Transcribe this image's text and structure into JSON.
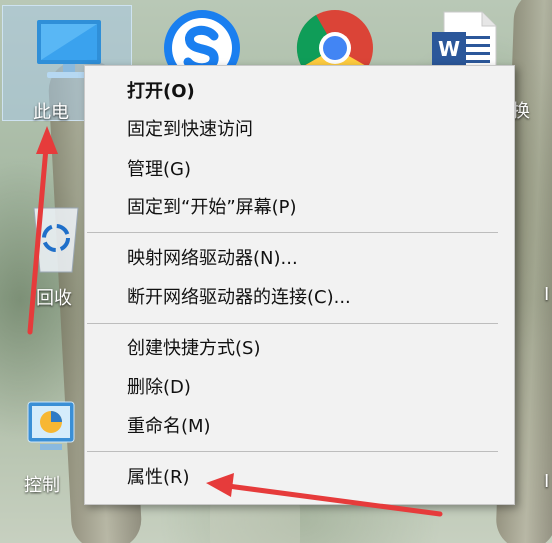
{
  "desktop": {
    "icons": [
      {
        "label": "此电",
        "name": "this-pc-icon"
      },
      {
        "label": "回收",
        "name": "recycle-bin-icon"
      },
      {
        "label": "控制",
        "name": "control-panel-icon"
      }
    ],
    "right_labels": [
      "换"
    ]
  },
  "menu": {
    "items": [
      {
        "label": "打开(O)",
        "bold": true
      },
      {
        "label": "固定到快速访问"
      },
      {
        "label": "管理(G)"
      },
      {
        "label": "固定到“开始”屏幕(P)"
      },
      {
        "label": "映射网络驱动器(N)..."
      },
      {
        "label": "断开网络驱动器的连接(C)..."
      },
      {
        "label": "创建快捷方式(S)"
      },
      {
        "label": "删除(D)"
      },
      {
        "label": "重命名(M)"
      },
      {
        "label": "属性(R)"
      }
    ]
  },
  "colors": {
    "arrow": "#e63b3b",
    "menu_bg": "#f2f2f2",
    "selection": "#cce8ff"
  }
}
